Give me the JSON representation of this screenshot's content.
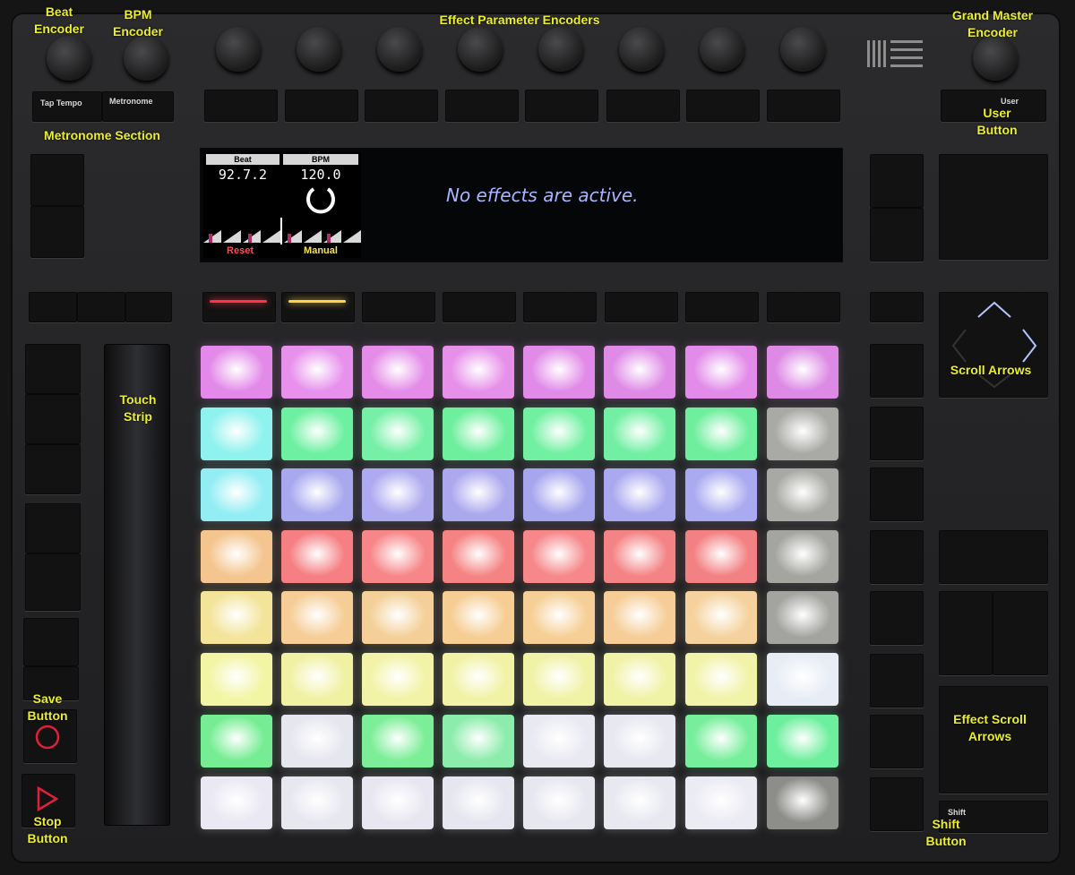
{
  "labels": {
    "beat_encoder": "Beat\nEncoder",
    "bpm_encoder": "BPM\nEncoder",
    "effect_parameter_encoders": "Effect Parameter Encoders",
    "grand_master_encoder": "Grand Master\nEncoder",
    "metronome_section": "Metronome Section",
    "user_button": "User\nButton",
    "touch_strip": "Touch\nStrip",
    "scroll_arrows": "Scroll Arrows",
    "save_button": "Save\nButton",
    "stop_button": "Stop\nButton",
    "effect_scroll_arrows": "Effect Scroll\nArrows",
    "shift_button": "Shift\nButton"
  },
  "buttons": {
    "tap_tempo": "Tap Tempo",
    "metronome": "Metronome",
    "user": "User",
    "shift": "Shift"
  },
  "display": {
    "beat_header": "Beat",
    "bpm_header": "BPM",
    "beat_value": "92.7.2",
    "bpm_value": "120.0",
    "reset": "Reset",
    "manual": "Manual",
    "message": "No effects are active."
  },
  "pad_colors": [
    [
      "#e389e9",
      "#e790ec",
      "#e48ce8",
      "#e790ea",
      "#e18ae8",
      "#df8ae6",
      "#e28be9",
      "#dd8ae5"
    ],
    [
      "#8ff2ee",
      "#6ef0a2",
      "#75f0a6",
      "#6eef9e",
      "#72f0a2",
      "#73efa4",
      "#6fee9e",
      "#a9aaa6"
    ],
    [
      "#93eef3",
      "#a7a8ee",
      "#aeaaf0",
      "#aca8ee",
      "#a6a6ef",
      "#aaa8ef",
      "#a9aaf0",
      "#a8a9a4"
    ],
    [
      "#f4c58e",
      "#f57f82",
      "#f78688",
      "#f58383",
      "#f6878a",
      "#f48385",
      "#f38083",
      "#a4a5a0"
    ],
    [
      "#f3e49a",
      "#f6cd96",
      "#f4d098",
      "#f6cd93",
      "#f6cf96",
      "#f6cd97",
      "#f5d29d",
      "#a3a4a0"
    ],
    [
      "#f2f5a4",
      "#f1f1a4",
      "#f2f3a7",
      "#f1f2a5",
      "#f0f2a6",
      "#f0f2a5",
      "#f1f3a8",
      "#e8ecf5"
    ],
    [
      "#76ed93",
      "#e6e6ef",
      "#7cee97",
      "#8cecac",
      "#e9e9f2",
      "#e7e8f0",
      "#77ee9b",
      "#6eef9e"
    ],
    [
      "#e9e8f3",
      "#e7e7f0",
      "#e8e7f1",
      "#e5e6ef",
      "#e7e7f0",
      "#e7e8f0",
      "#ebebf3",
      "#8d8e8a"
    ]
  ],
  "accent": {
    "label_yellow": "#ecee2c",
    "led_red": "#ff3344",
    "led_yellow": "#ffd34a",
    "screen_text": "#a9b6ff"
  }
}
